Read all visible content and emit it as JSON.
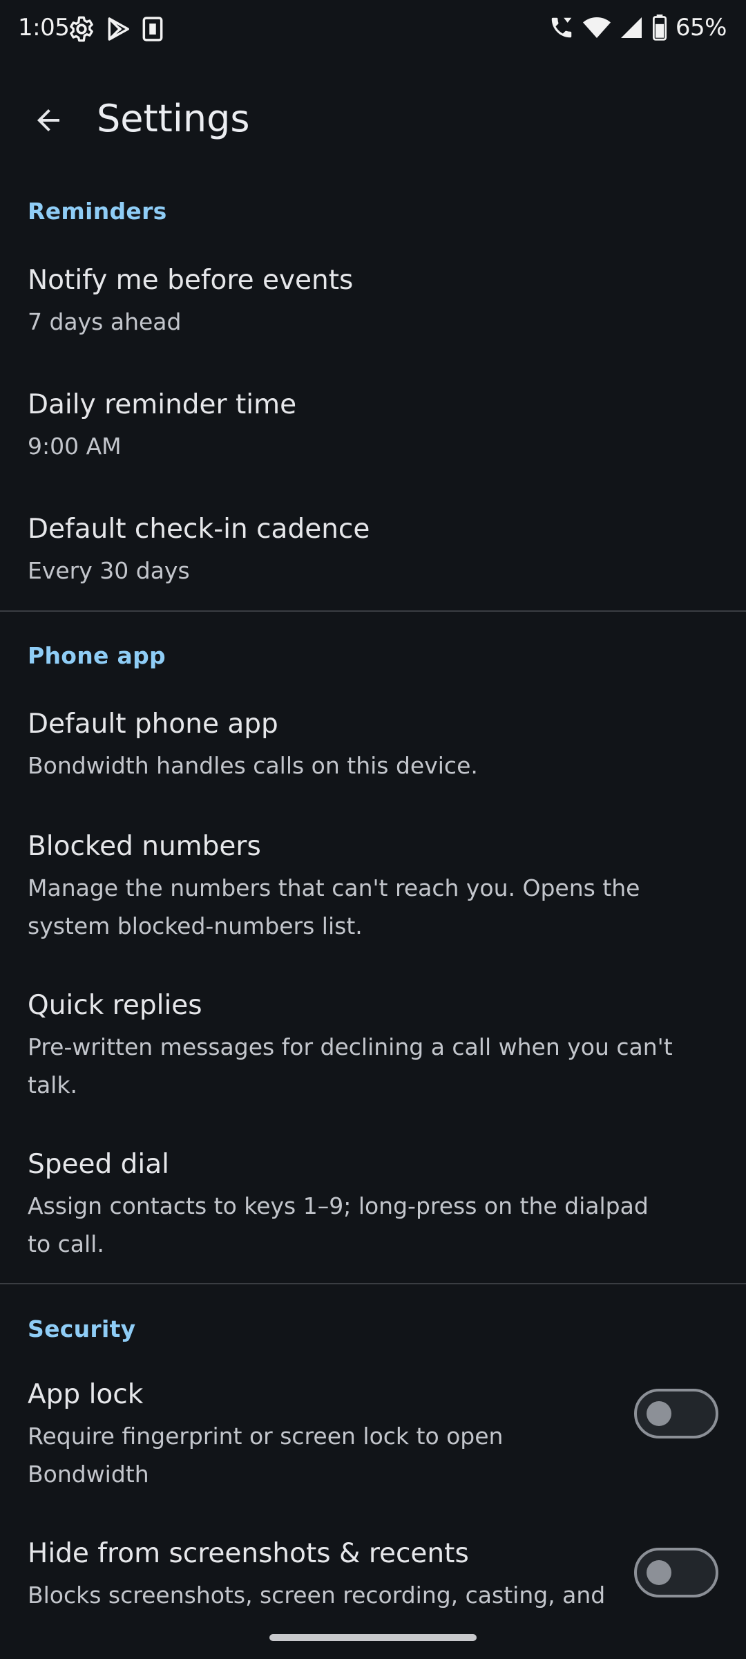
{
  "status_bar": {
    "time": "1:05",
    "battery": "65%",
    "icons": [
      "gear-icon",
      "play-store-icon",
      "sim-card-icon",
      "wifi-calling-icon",
      "wifi-icon",
      "signal-icon",
      "battery-icon"
    ]
  },
  "app_bar": {
    "title": "Settings",
    "back_icon": "arrow-back-icon"
  },
  "sections": {
    "reminders": {
      "header": "Reminders",
      "items": [
        {
          "title": "Notify me before events",
          "summary": "7 days ahead"
        },
        {
          "title": "Daily reminder time",
          "summary": "9:00 AM"
        },
        {
          "title": "Default check-in cadence",
          "summary": "Every 30 days"
        }
      ]
    },
    "phone_app": {
      "header": "Phone app",
      "items": [
        {
          "title": "Default phone app",
          "summary": "Bondwidth handles calls on this device."
        },
        {
          "title": "Blocked numbers",
          "summary": "Manage the numbers that can't reach you. Opens the system blocked-numbers list."
        },
        {
          "title": "Quick replies",
          "summary": "Pre-written messages for declining a call when you can't talk."
        },
        {
          "title": "Speed dial",
          "summary": "Assign contacts to keys 1–9; long-press on the dialpad to call."
        }
      ]
    },
    "security": {
      "header": "Security",
      "items": [
        {
          "title": "App lock",
          "summary": "Require fingerprint or screen lock to open Bondwidth",
          "enabled": false
        },
        {
          "title": "Hide from screenshots & recents",
          "summary": "Blocks screenshots, screen recording, casting, and",
          "enabled": false
        }
      ]
    }
  },
  "colors": {
    "background": "#111418",
    "accent": "#8fcdf6",
    "title_text": "#e6e7ea",
    "summary_text": "#c3c6cc",
    "divider": "#3a3d42"
  }
}
